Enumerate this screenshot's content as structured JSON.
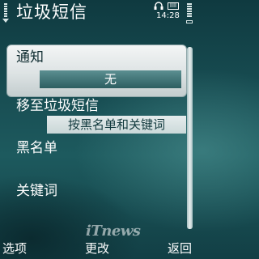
{
  "status_bar": {
    "title": "垃圾短信",
    "clock": "14:28",
    "message_indicator": "IIII",
    "icons": [
      "signal-strength-icon",
      "headset-icon",
      "message-indicator-icon",
      "battery-icon"
    ]
  },
  "settings": [
    {
      "label": "通知",
      "value": "无",
      "selected": true
    },
    {
      "label": "移至垃圾短信",
      "value": "按黑名单和关键词"
    },
    {
      "label": "黑名单"
    },
    {
      "label": "关键词"
    }
  ],
  "watermark": "iTnews",
  "softkeys": {
    "left": "选项",
    "middle": "更改",
    "right": "返回"
  },
  "colors": {
    "background": "#1a5257",
    "selection": "#e6ebeb",
    "value_field": "#2c5e61",
    "text": "#ffffff"
  }
}
